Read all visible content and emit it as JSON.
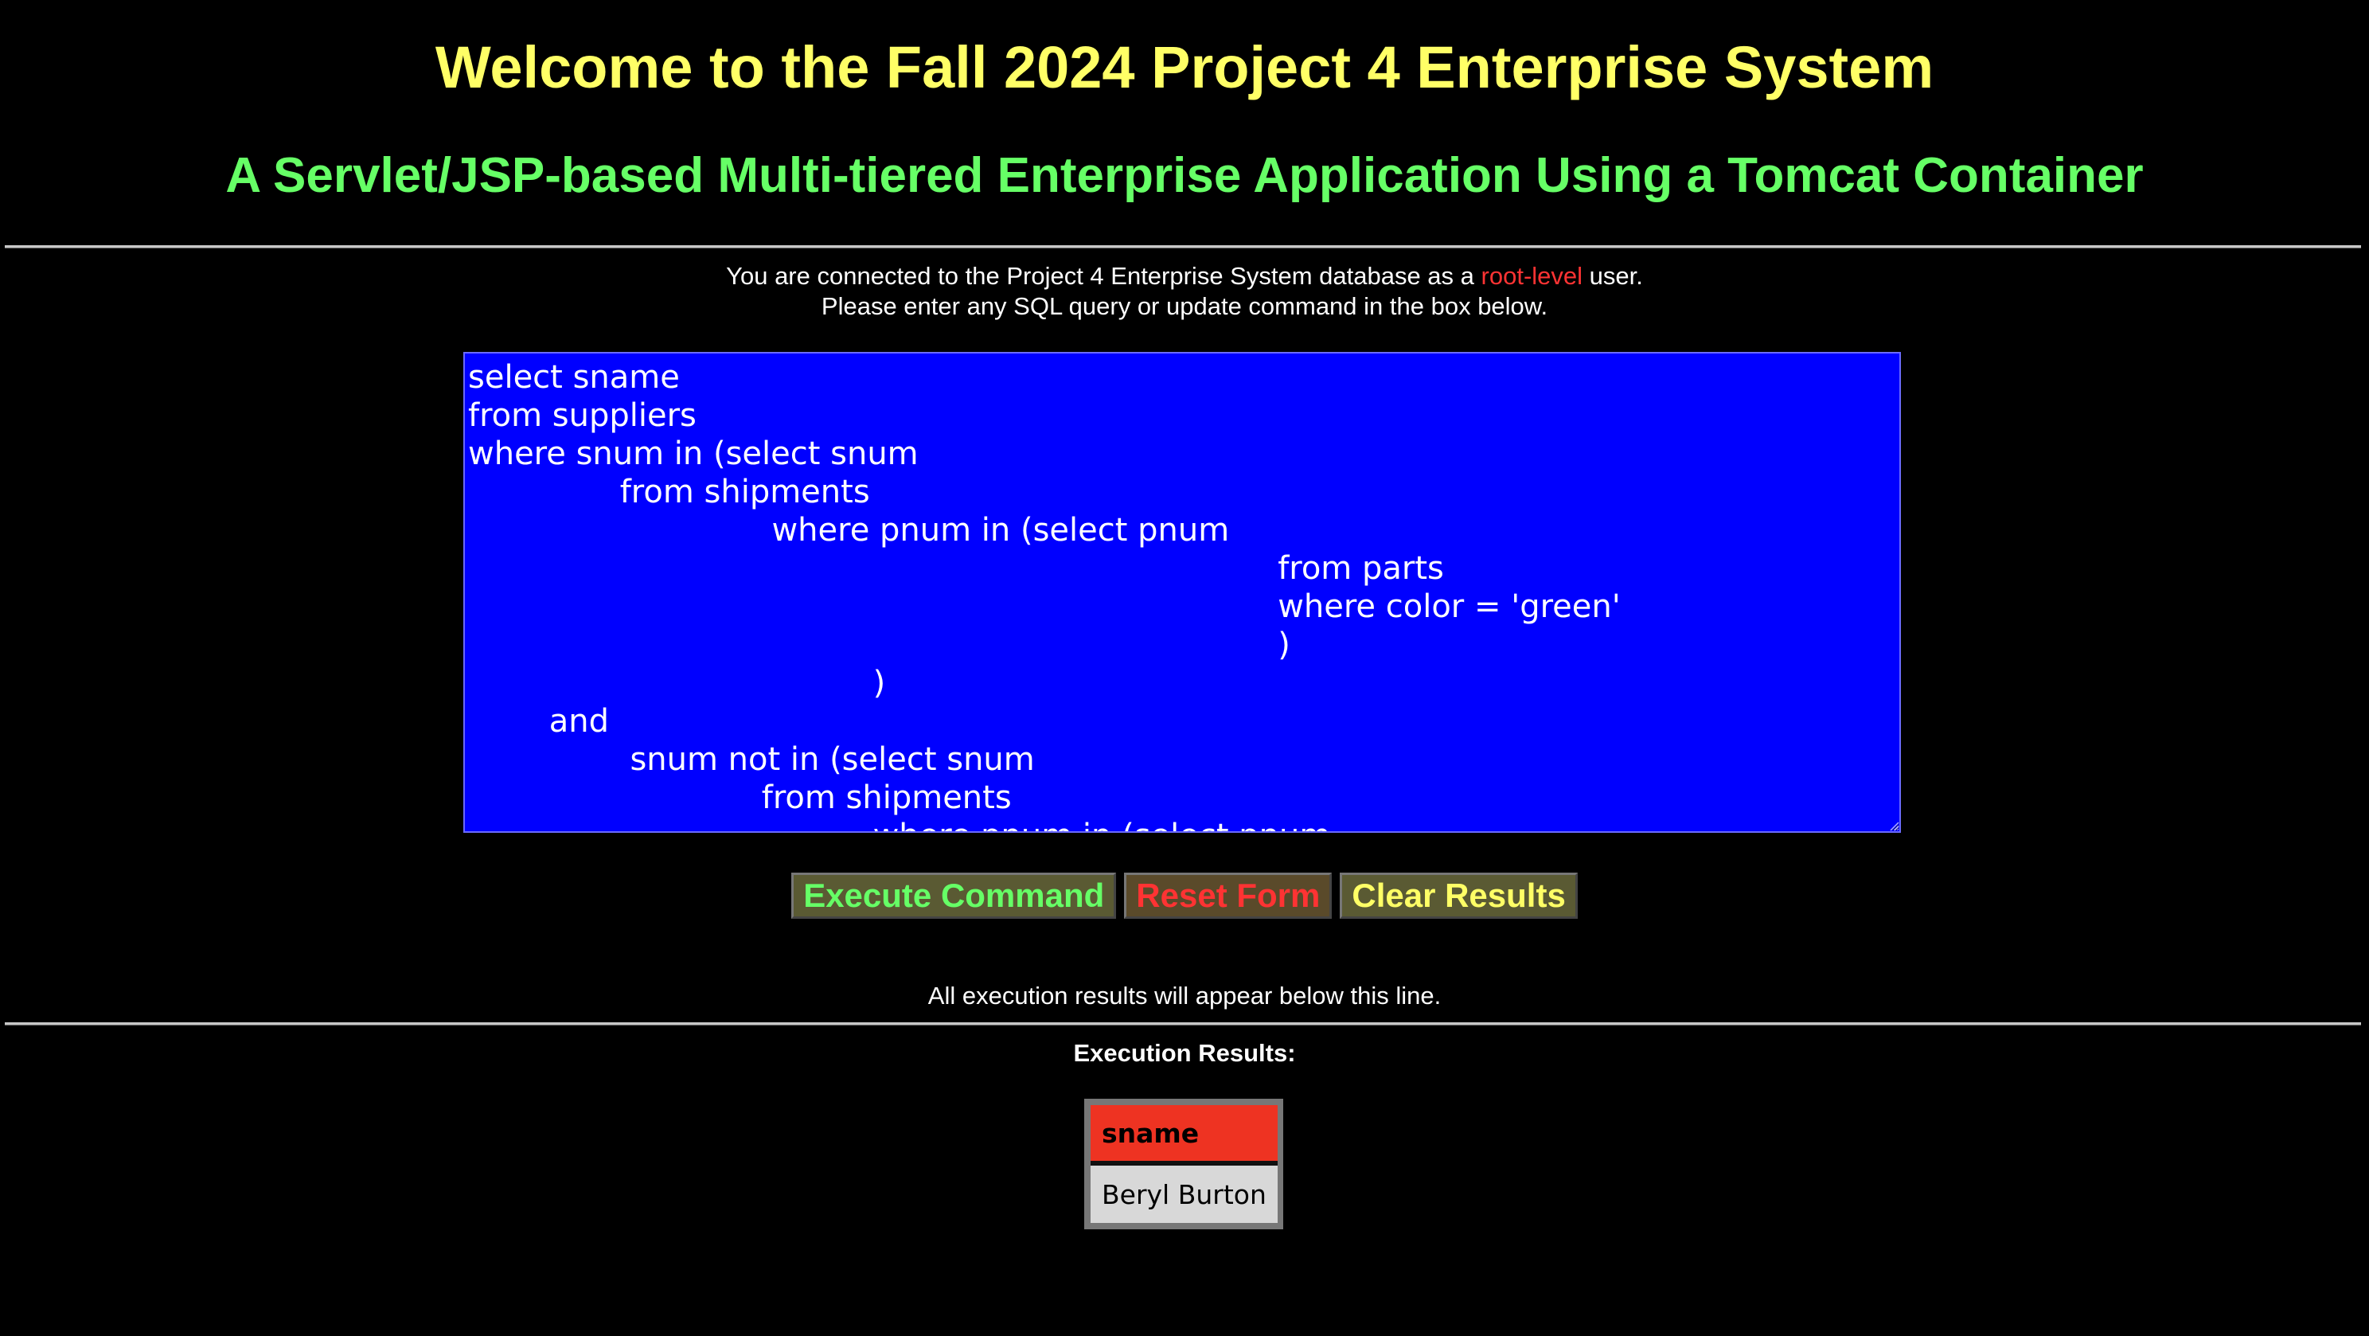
{
  "header": {
    "title": "Welcome to the Fall 2024 Project 4 Enterprise System",
    "subtitle": "A Servlet/JSP-based Multi-tiered Enterprise Application Using a Tomcat Container"
  },
  "connection_info": {
    "line1_prefix": "You are connected to the Project 4 Enterprise System database as a ",
    "user_level": "root-level",
    "line1_suffix": " user.",
    "line2": "Please enter any SQL query or update command in the box below."
  },
  "query": {
    "value": "select sname\nfrom suppliers\nwhere snum in (select snum\n               from shipments\n                              where pnum in (select pnum\n                                                                                from parts\n                                                                                where color = 'green'\n                                                                                )\n                                        )\n        and\n                snum not in (select snum\n                             from shipments\n                                        where pnum in (select pnum"
  },
  "buttons": {
    "execute": "Execute Command",
    "reset": "Reset Form",
    "clear": "Clear Results"
  },
  "results": {
    "notice": "All execution results will appear below this line.",
    "label": "Execution Results:",
    "columns": [
      "sname"
    ],
    "rows": [
      [
        "Beryl Burton"
      ]
    ]
  },
  "colors": {
    "background": "#000000",
    "title": "#ffff66",
    "subtitle": "#66ff66",
    "root_level": "#ff3333",
    "query_background": "#0000ff",
    "header_cell": "#ee3322",
    "data_cell": "#d8d8d8"
  }
}
